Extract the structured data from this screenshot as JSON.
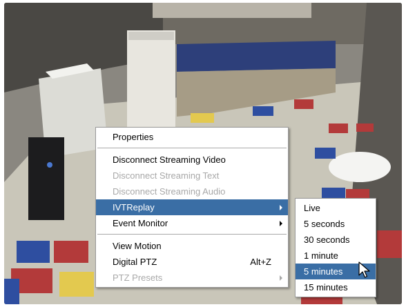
{
  "context_menu": {
    "items": [
      {
        "label": "Properties",
        "state": "normal"
      },
      {
        "label": "Disconnect Streaming Video",
        "state": "normal"
      },
      {
        "label": "Disconnect Streaming Text",
        "state": "disabled"
      },
      {
        "label": "Disconnect Streaming Audio",
        "state": "disabled"
      },
      {
        "label": "IVTReplay",
        "state": "selected"
      },
      {
        "label": "Event Monitor",
        "state": "normal"
      },
      {
        "label": "View Motion",
        "state": "normal"
      },
      {
        "label": "Digital PTZ",
        "shortcut": "Alt+Z",
        "state": "normal"
      },
      {
        "label": "PTZ Presets",
        "state": "disabled"
      }
    ]
  },
  "replay_submenu": {
    "items": [
      {
        "label": "Live"
      },
      {
        "label": "5 seconds"
      },
      {
        "label": "30 seconds"
      },
      {
        "label": "1 minute"
      },
      {
        "label": "5 minutes",
        "selected": true
      },
      {
        "label": "15 minutes"
      }
    ]
  },
  "icons": {
    "submenu_arrow": "triangle-right-icon",
    "cursor": "mouse-pointer-icon"
  },
  "colors": {
    "selection": "#3a6ea5",
    "disabled_text": "#a8a8a8",
    "menu_background": "#ffffff"
  }
}
